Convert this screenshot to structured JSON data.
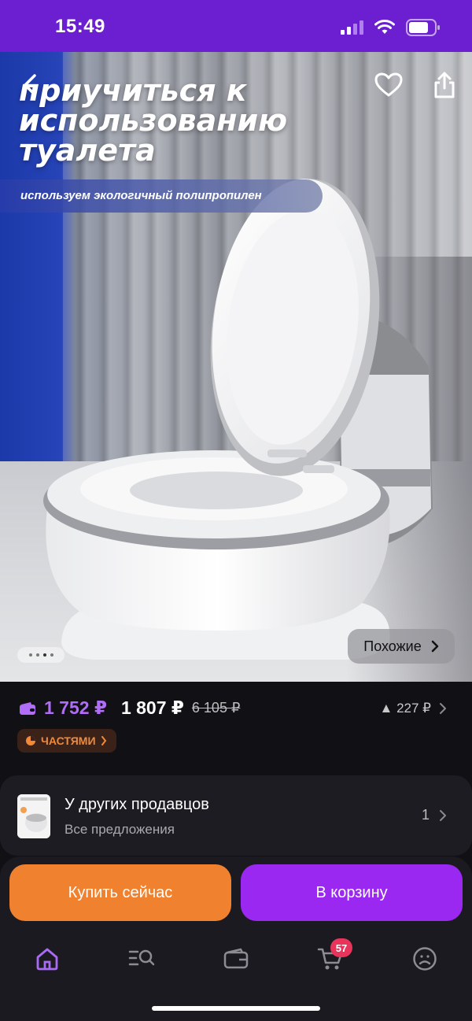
{
  "status_bar": {
    "time": "15:49"
  },
  "hero": {
    "title_lines": [
      "приучиться к",
      "использованию",
      "туалета"
    ],
    "subtitle": "используем экологичный полипропилен",
    "similar_label": "Похожие",
    "slide_count": 4,
    "active_slide": 3
  },
  "price": {
    "wallet_price": "1 752 ₽",
    "price": "1 807 ₽",
    "old_price": "6 105 ₽",
    "delta": "▲ 227 ₽",
    "installments_label": "ЧАСТЯМИ"
  },
  "sellers": {
    "title": "У других продавцов",
    "subtitle": "Все предложения",
    "count": "1"
  },
  "actions": {
    "buy_now": "Купить сейчас",
    "add_to_cart": "В корзину"
  },
  "tabbar": {
    "items": [
      "home-icon",
      "catalog-search-icon",
      "wallet-icon",
      "cart-icon",
      "profile-icon"
    ],
    "cart_badge": "57"
  },
  "colors": {
    "status_bar": "#6b1fd0",
    "accent_purple": "#9a28f0",
    "accent_orange": "#f0812e",
    "wallet_price": "#b06df7",
    "badge": "#e8345a"
  }
}
